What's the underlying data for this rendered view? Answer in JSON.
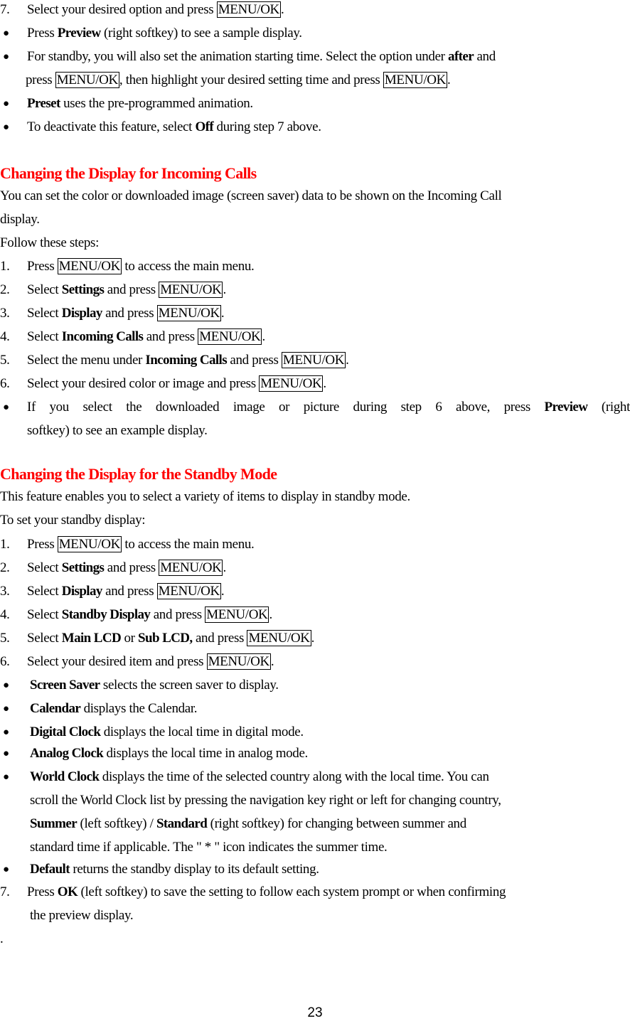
{
  "key_label": "MENU/OK",
  "intro": {
    "step7": {
      "num": "7.",
      "pre": "Select your desired option and press ",
      "post": "."
    },
    "bullets": [
      {
        "bold": "Preview",
        "text": " (right softkey) to see a sample display.",
        "pre": "Press "
      },
      {
        "line1_pre": "For standby, you will also set the animation starting time. Select the option under ",
        "line1_bold": "after",
        "line1_post": " and",
        "line2_pre": "press ",
        "line2_mid": ", then highlight your desired setting time and press ",
        "line2_post": "."
      },
      {
        "bold": "Preset",
        "text": " uses the pre-programmed animation."
      },
      {
        "pre": "To deactivate this feature, select ",
        "bold": "Off",
        "text": " during step 7 above."
      }
    ]
  },
  "section1": {
    "heading": "Changing the Display for Incoming Calls",
    "desc_line1": "You can set the color or downloaded image (screen saver) data to be shown on the Incoming Call",
    "desc_line2": "display.",
    "follow": "Follow these steps:",
    "steps": [
      {
        "num": "1.",
        "pre": "Press ",
        "post": " to access the main menu."
      },
      {
        "num": "2.",
        "pre": "Select ",
        "bold": "Settings",
        "mid": " and press ",
        "post": "."
      },
      {
        "num": "3.",
        "pre": "Select ",
        "bold": "Display",
        "mid": " and press ",
        "post": "."
      },
      {
        "num": "4.",
        "pre": "Select ",
        "bold": "Incoming Calls",
        "mid": " and press ",
        "post": "."
      },
      {
        "num": "5.",
        "pre": "Select the menu under ",
        "bold": "Incoming Calls",
        "mid": " and press ",
        "post": "."
      },
      {
        "num": "6.",
        "pre": "Select your desired color or image and press ",
        "post": "."
      }
    ],
    "note": {
      "pre": "If you select the downloaded image or picture during step 6 above, press ",
      "bold": "Preview",
      "post": " (right",
      "line2": "softkey) to see an example display."
    }
  },
  "section2": {
    "heading": "Changing the Display for the Standby Mode",
    "desc": "This feature enables you to select a variety of items to display in standby mode.",
    "follow": "To set your standby display:",
    "steps": [
      {
        "num": "1.",
        "pre": "Press ",
        "post": " to access the main menu."
      },
      {
        "num": "2.",
        "pre": "Select ",
        "bold": "Settings",
        "mid": " and press ",
        "post": "."
      },
      {
        "num": "3.",
        "pre": "Select ",
        "bold": "Display",
        "mid": " and press ",
        "post": "."
      },
      {
        "num": "4.",
        "pre": "Select ",
        "bold": "Standby Display",
        "mid": " and press ",
        "post": "."
      },
      {
        "num": "5.",
        "pre": "Select ",
        "bold": "Main LCD",
        "mid0": " or ",
        "bold2": "Sub LCD,",
        "mid": " and press ",
        "post": "."
      },
      {
        "num": "6.",
        "pre": "Select your desired item and press ",
        "post": "."
      }
    ],
    "items": [
      {
        "bold": "Screen Saver",
        "text": " selects the screen saver to display."
      },
      {
        "bold": "Calendar",
        "text": " displays the Calendar."
      },
      {
        "bold": "Digital Clock",
        "text": " displays the local time in digital mode."
      },
      {
        "bold": "Analog Clock",
        "text": " displays the local time in analog mode."
      },
      {
        "bold": "World Clock",
        "text": " displays the time of the selected country along with the local time. You can",
        "line2": "scroll the World Clock list by pressing the navigation key right or left for changing country,",
        "line3_bold1": "Summer",
        "line3_mid": " (left softkey) / ",
        "line3_bold2": "Standard",
        "line3_post": " (right softkey) for changing between summer and",
        "line4": "standard time if applicable. The \" * \" icon indicates the summer time."
      },
      {
        "bold": "Default",
        "text": " returns the standby display to its default setting."
      }
    ],
    "step7": {
      "num": "7.",
      "pre": "Press ",
      "bold": "OK",
      "post": " (left softkey) to save the setting to follow each system prompt or when confirming",
      "line2": "the preview display."
    }
  },
  "trailing_dot": ".",
  "page_number": "23",
  "colors": {
    "heading": "#ff0000",
    "text": "#000000"
  }
}
